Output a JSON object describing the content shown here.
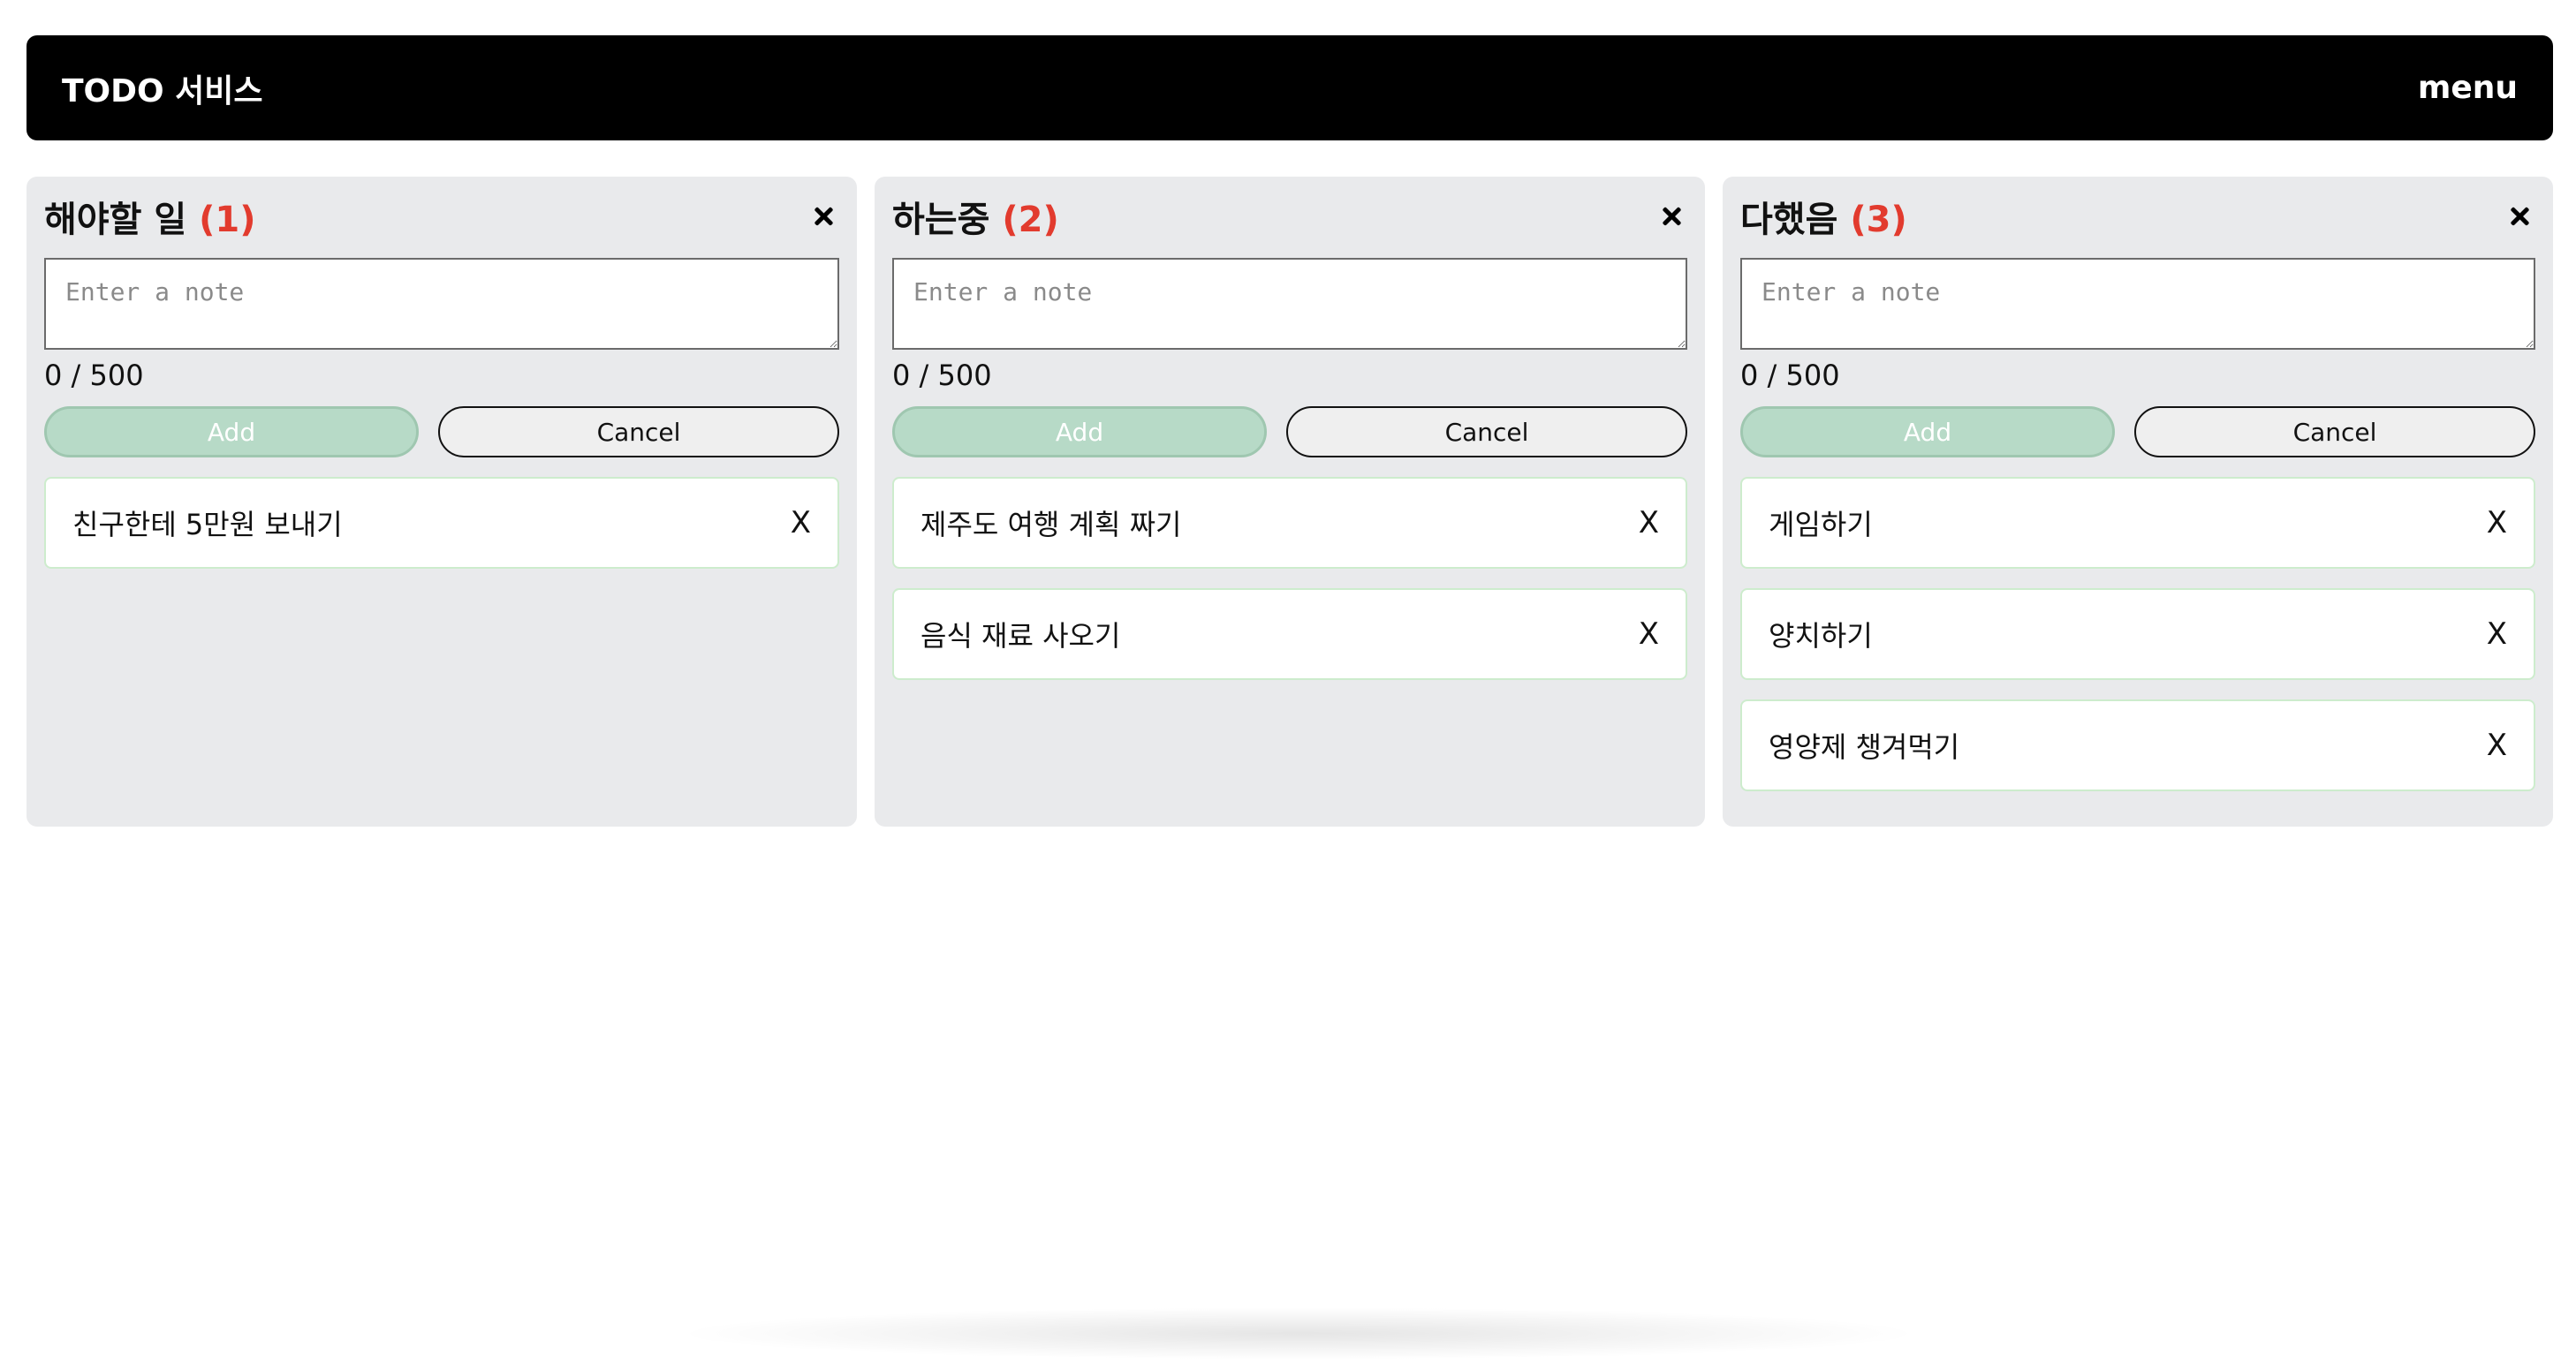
{
  "header": {
    "title": "TODO 서비스",
    "menu_label": "menu"
  },
  "columns": [
    {
      "title": "해야할 일",
      "count_label": "(1)",
      "textarea_placeholder": "Enter a note",
      "char_counter": "0 / 500",
      "add_label": "Add",
      "cancel_label": "Cancel",
      "cards": [
        {
          "text": "친구한테 5만원 보내기",
          "delete_label": "X"
        }
      ]
    },
    {
      "title": "하는중",
      "count_label": "(2)",
      "textarea_placeholder": "Enter a note",
      "char_counter": "0 / 500",
      "add_label": "Add",
      "cancel_label": "Cancel",
      "cards": [
        {
          "text": "제주도 여행 계획 짜기",
          "delete_label": "X"
        },
        {
          "text": "음식 재료 사오기",
          "delete_label": "X"
        }
      ]
    },
    {
      "title": "다했음",
      "count_label": "(3)",
      "textarea_placeholder": "Enter a note",
      "char_counter": "0 / 500",
      "add_label": "Add",
      "cancel_label": "Cancel",
      "cards": [
        {
          "text": "게임하기",
          "delete_label": "X"
        },
        {
          "text": "양치하기",
          "delete_label": "X"
        },
        {
          "text": "영양제 챙겨먹기",
          "delete_label": "X"
        }
      ]
    }
  ],
  "colors": {
    "header_bg": "#000000",
    "column_bg": "#e9eaec",
    "count_accent": "#e23b2e",
    "add_button_bg": "#b7dac7",
    "card_border": "#cdeccd"
  },
  "icons": {
    "column_close": "close-icon"
  }
}
